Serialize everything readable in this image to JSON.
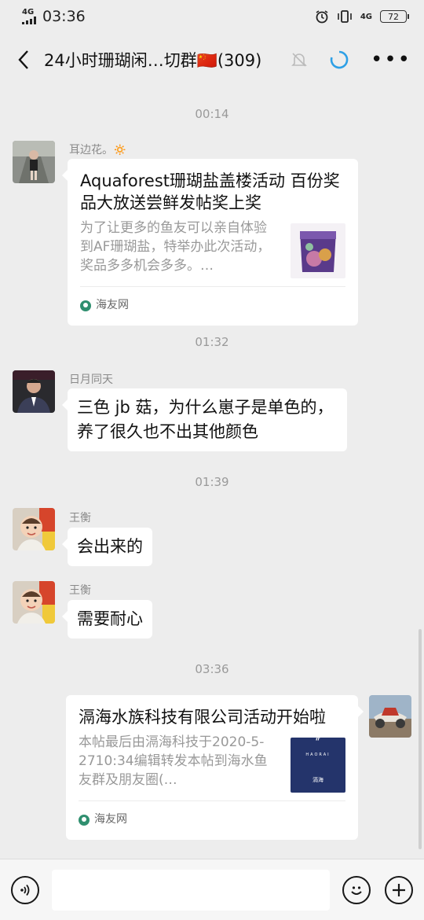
{
  "status_bar": {
    "network": "4G",
    "time": "03:36",
    "network_right": "4G",
    "battery": "72"
  },
  "header": {
    "title": "24小时珊瑚闲…切群🇨🇳(309)"
  },
  "messages": {
    "t1": "00:14",
    "m1": {
      "sender": "耳边花。🔅",
      "card_title": "Aquaforest珊瑚盐盖楼活动 百份奖品大放送尝鲜发帖奖上奖",
      "card_desc": "为了让更多的鱼友可以亲自体验到AF珊瑚盐，特举办此次活动，奖品多多机会多多。…",
      "source": "海友网"
    },
    "t2": "01:32",
    "m2": {
      "sender": "日月同天",
      "text": "三色 jb 菇，为什么崽子是单色的，养了很久也不出其他颜色"
    },
    "t3": "01:39",
    "m3": {
      "sender": "王衡",
      "text": "会出来的"
    },
    "m4": {
      "sender": "王衡",
      "text": "需要耐心"
    },
    "t4": "03:36",
    "m5": {
      "card_title": "滆海水族科技有限公司活动开始啦",
      "card_desc": "本帖最后由滆海科技于2020-5-2710:34编辑转发本帖到海水鱼友群及朋友圈(…",
      "source": "海友网",
      "thumb_logo": "HAORAI",
      "thumb_sub": "滆海"
    }
  },
  "colors": {
    "background": "#ededed",
    "bubble": "#ffffff",
    "accent_loading": "#2ea0e6",
    "thumb_blue": "#24346b"
  }
}
